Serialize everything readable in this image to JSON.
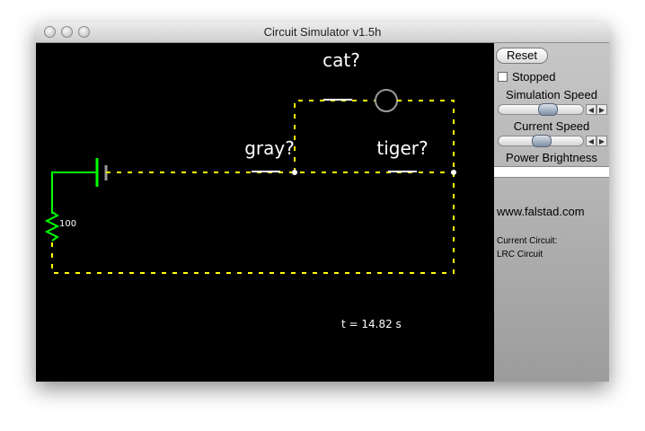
{
  "window": {
    "title": "Circuit Simulator v1.5h"
  },
  "canvas": {
    "labels": {
      "cat": "cat?",
      "gray": "gray?",
      "tiger": "tiger?"
    },
    "resistor_value": "100",
    "time_readout": "t = 14.82 s",
    "colors": {
      "wire": "#ffff00",
      "battery": "#00ff00",
      "bulb": "#9a9a9a",
      "background": "#000000"
    }
  },
  "panel": {
    "reset_label": "Reset",
    "stopped_label": "Stopped",
    "stopped_checked": false,
    "simulation_speed_label": "Simulation Speed",
    "current_speed_label": "Current Speed",
    "power_brightness_label": "Power Brightness",
    "website": "www.falstad.com",
    "current_circuit_label": "Current Circuit:",
    "current_circuit_name": "LRC Circuit",
    "simulation_speed_level": 0.6,
    "current_speed_level": 0.5
  }
}
